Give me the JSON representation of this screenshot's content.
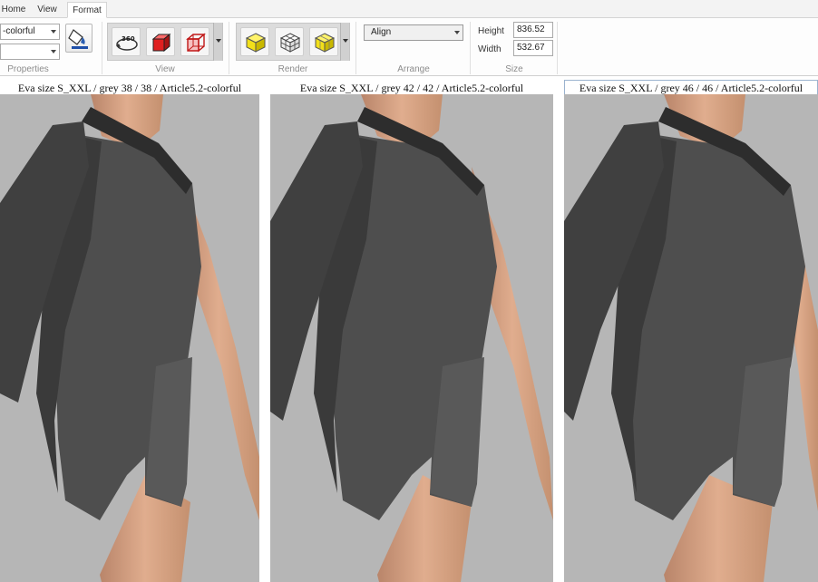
{
  "ribbon": {
    "tabs": [
      {
        "label": "Home"
      },
      {
        "label": "View"
      },
      {
        "label": "Format"
      }
    ],
    "active_tab": "Format",
    "properties": {
      "combo1_value": "-colorful",
      "combo2_value": "",
      "title": "Properties"
    },
    "view": {
      "title": "View",
      "buttons": [
        "rotate-360-icon",
        "red-cube-icon",
        "red-wireframe-cube-icon"
      ]
    },
    "render": {
      "title": "Render",
      "buttons": [
        "yellow-cube-icon",
        "wireframe-cube-icon",
        "yellow-mesh-cube-icon"
      ]
    },
    "arrange": {
      "title": "Arrange",
      "align_value": "Align"
    },
    "size": {
      "title": "Size",
      "height_label": "Height",
      "height_value": "836.52",
      "width_label": "Width",
      "width_value": "532.67"
    }
  },
  "viewports": [
    {
      "title": "Eva size S_XXL / grey 38 / 38 / Article5.2-colorful"
    },
    {
      "title": "Eva size S_XXL / grey 42 / 42 / Article5.2-colorful"
    },
    {
      "title": "Eva size S_XXL / grey 46 / 46 / Article5.2-colorful"
    }
  ],
  "colors": {
    "viewport_bg": "#b6b6b6",
    "garment_dark": "#3e3e3e",
    "garment_light": "#5a5a5a",
    "skin": "#d9a383",
    "cube_red": "#e02020",
    "cube_yellow": "#f2e01a"
  }
}
